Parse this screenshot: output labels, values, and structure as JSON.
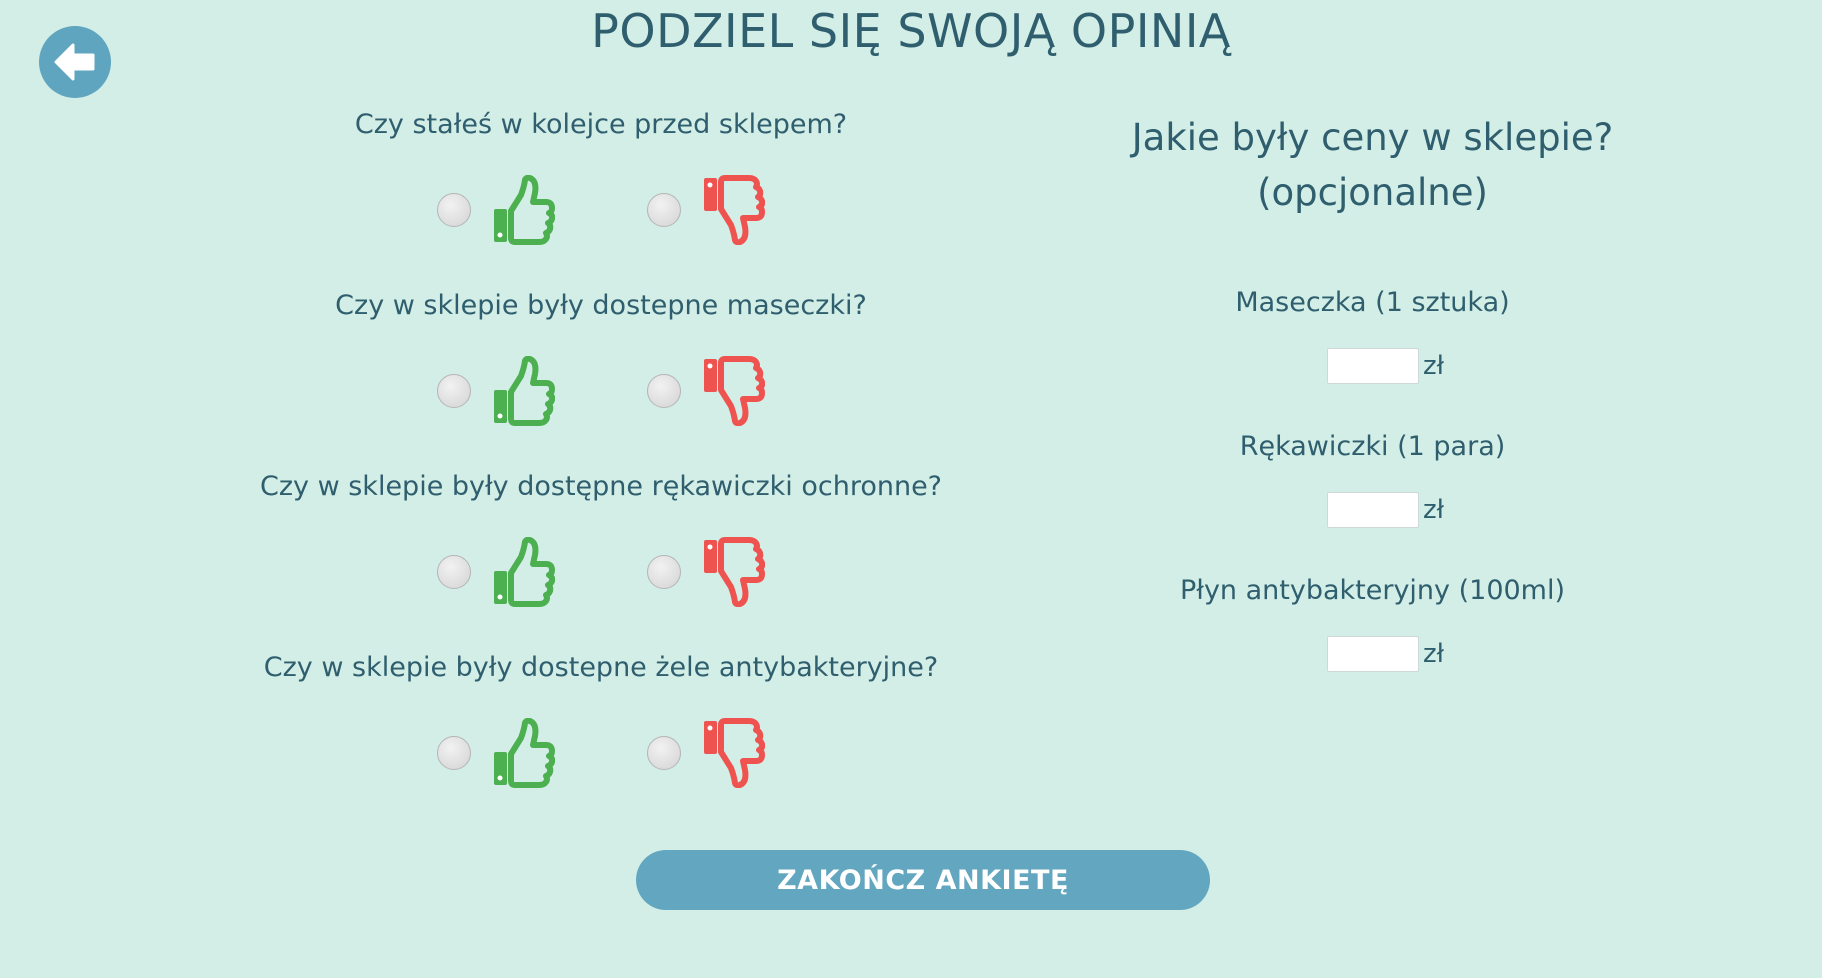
{
  "header": {
    "title": "PODZIEL SIĘ SWOJĄ OPINIĄ",
    "back_icon": "arrow-left-icon"
  },
  "questions": [
    {
      "text": "Czy stałeś w kolejce przed sklepem?"
    },
    {
      "text": "Czy w sklepie były dostepne maseczki?"
    },
    {
      "text": "Czy w sklepie były dostępne rękawiczki ochronne?"
    },
    {
      "text": "Czy w sklepie były dostepne żele antybakteryjne?"
    }
  ],
  "answer_icons": {
    "yes": "thumbs-up-icon",
    "no": "thumbs-down-icon",
    "yes_color": "#4caf50",
    "no_color": "#ef5350"
  },
  "prices": {
    "heading_line1": "Jakie były ceny w sklepie?",
    "heading_line2": "(opcjonalne)",
    "items": [
      {
        "label": "Maseczka (1 sztuka)",
        "value": "",
        "currency": "zł"
      },
      {
        "label": "Rękawiczki (1 para)",
        "value": "",
        "currency": "zł"
      },
      {
        "label": "Płyn antybakteryjny (100ml)",
        "value": "",
        "currency": "zł"
      }
    ]
  },
  "submit": {
    "label": "ZAKOŃCZ ANKIETĘ"
  },
  "colors": {
    "background": "#d3eee6",
    "text": "#2f5e6e",
    "accent": "#62a6bf"
  }
}
